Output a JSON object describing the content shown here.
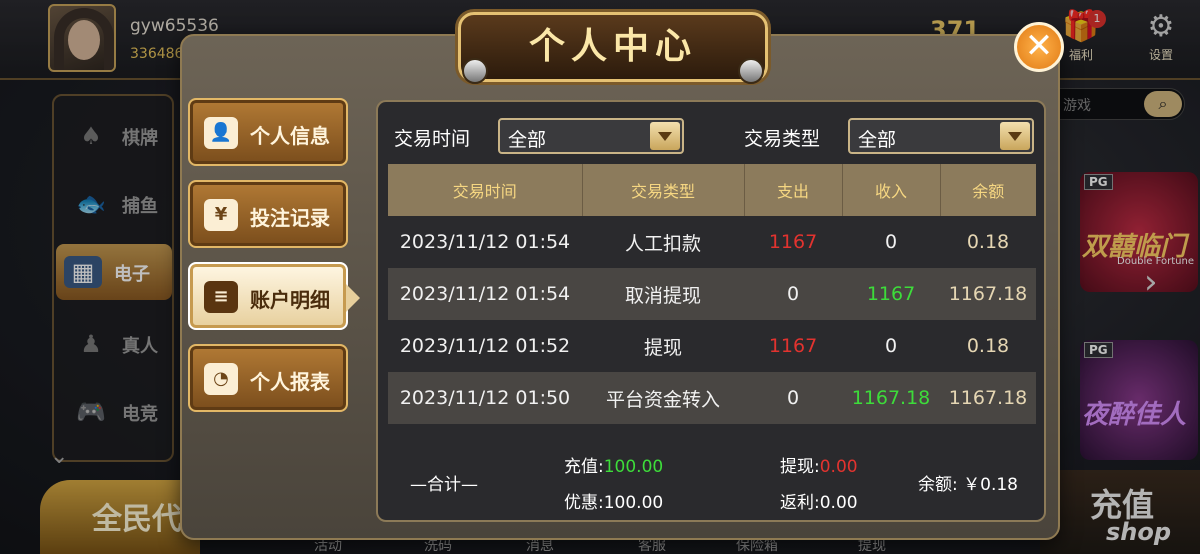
{
  "user": {
    "name": "gyw65536",
    "id": "336486"
  },
  "balance_display": "371",
  "top_icons": [
    {
      "label": "福利",
      "icon": "gift-icon",
      "badge": "1"
    },
    {
      "label": "设置",
      "icon": "gear-icon"
    }
  ],
  "search": {
    "placeholder": "游戏"
  },
  "nav": [
    {
      "label": "棋牌",
      "icon": "cards-icon"
    },
    {
      "label": "捕鱼",
      "icon": "fish-icon"
    },
    {
      "label": "电子",
      "icon": "slot-machine-icon",
      "active": true
    },
    {
      "label": "真人",
      "icon": "person-icon"
    },
    {
      "label": "电竞",
      "icon": "gamepad-icon"
    }
  ],
  "promo_label": "全民代",
  "bottom_tabs": [
    "活动",
    "洗码",
    "消息",
    "客服",
    "保险箱",
    "提现"
  ],
  "games": [
    {
      "badge": "PG",
      "title": "双囍临门",
      "subtitle": "Double Fortune"
    },
    {
      "badge": "PG",
      "title": "夜醉佳人",
      "subtitle": ""
    }
  ],
  "shop": {
    "title": "充值",
    "subtitle": "shop"
  },
  "modal": {
    "title": "个人中心",
    "tabs": [
      {
        "label": "个人信息",
        "icon": "user-icon"
      },
      {
        "label": "投注记录",
        "icon": "bill-icon"
      },
      {
        "label": "账户明细",
        "icon": "document-icon",
        "active": true
      },
      {
        "label": "个人报表",
        "icon": "pie-chart-icon"
      }
    ],
    "filters": {
      "time_label": "交易时间",
      "time_value": "全部",
      "type_label": "交易类型",
      "type_value": "全部"
    },
    "table": {
      "headers": [
        "交易时间",
        "交易类型",
        "支出",
        "收入",
        "余额"
      ],
      "rows": [
        {
          "time": "2023/11/12 01:54",
          "type": "人工扣款",
          "out": "1167",
          "in": "0",
          "balance": "0.18"
        },
        {
          "time": "2023/11/12 01:54",
          "type": "取消提现",
          "out": "0",
          "in": "1167",
          "balance": "1167.18"
        },
        {
          "time": "2023/11/12 01:52",
          "type": "提现",
          "out": "1167",
          "in": "0",
          "balance": "0.18"
        },
        {
          "time": "2023/11/12 01:50",
          "type": "平台资金转入",
          "out": "0",
          "in": "1167.18",
          "balance": "1167.18"
        }
      ]
    },
    "summary": {
      "total_label": "—合计—",
      "recharge_label": "充值:",
      "recharge": "100.00",
      "withdraw_label": "提现:",
      "withdraw": "0.00",
      "discount_label": "优惠:",
      "discount": "100.00",
      "rebate_label": "返利:",
      "rebate": "0.00",
      "balance_label": "余额:",
      "balance": "￥0.18"
    }
  },
  "colors": {
    "accent_gold": "#e5c173",
    "income_green": "#3ddc3a",
    "expense_red": "#e2332f"
  }
}
